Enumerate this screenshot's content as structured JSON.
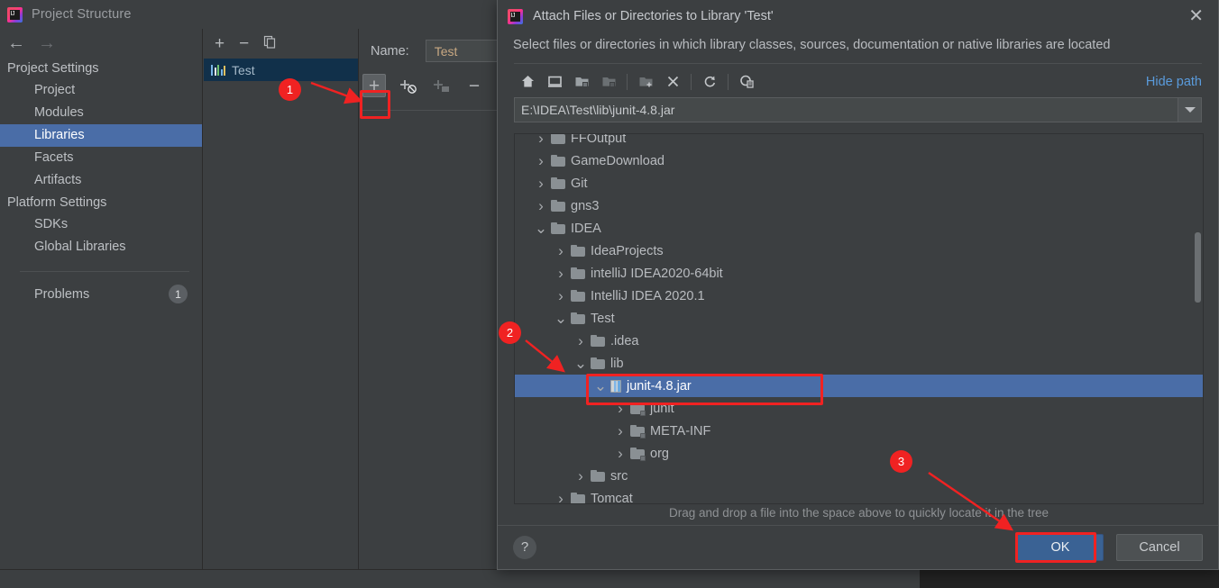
{
  "window": {
    "title": "Project Structure",
    "logo_icon": "intellij-idea-logo",
    "nav_back_icon": "arrow-left-icon",
    "nav_forward_icon": "arrow-right-icon"
  },
  "sidebar": {
    "groups": [
      {
        "label": "Project Settings",
        "items": [
          "Project",
          "Modules",
          "Libraries",
          "Facets",
          "Artifacts"
        ]
      },
      {
        "label": "Platform Settings",
        "items": [
          "SDKs",
          "Global Libraries"
        ]
      }
    ],
    "selected": "Libraries",
    "problems": {
      "label": "Problems",
      "count": "1"
    }
  },
  "library_list": {
    "toolbar": [
      {
        "name": "add-library-button",
        "glyph": "+"
      },
      {
        "name": "remove-library-button",
        "glyph": "−"
      },
      {
        "name": "copy-library-button",
        "glyph": "copy-icon"
      }
    ],
    "items": [
      {
        "label": "Test",
        "icon": "library-icon",
        "selected": true
      }
    ]
  },
  "detail": {
    "name_label": "Name:",
    "name_value": "Test",
    "buttons": [
      {
        "name": "add-attach-button",
        "glyph": "+",
        "state": "highlighted"
      },
      {
        "name": "add-source-button",
        "glyph": "+",
        "state": "normal"
      },
      {
        "name": "add-javadoc-button",
        "glyph": "+",
        "state": "disabled"
      },
      {
        "name": "remove-attachment-button",
        "glyph": "−",
        "state": "normal"
      }
    ]
  },
  "dialog": {
    "logo_icon": "intellij-idea-logo",
    "title": "Attach Files or Directories to Library 'Test'",
    "close_icon": "close-icon",
    "subtitle": "Select files or directories in which library classes, sources, documentation or native libraries are located",
    "toolbar": [
      {
        "name": "home-directory-button",
        "icon": "home-icon"
      },
      {
        "name": "desktop-directory-button",
        "icon": "desktop-icon"
      },
      {
        "name": "project-directory-button",
        "icon": "folder-project-icon"
      },
      {
        "name": "module-directory-button",
        "icon": "folder-module-icon"
      },
      {
        "name": "new-folder-button",
        "icon": "folder-plus-icon"
      },
      {
        "name": "delete-button",
        "icon": "close-x-icon"
      },
      {
        "name": "refresh-button",
        "icon": "refresh-icon"
      },
      {
        "name": "show-hidden-files-button",
        "icon": "hidden-files-icon"
      }
    ],
    "hide_path_label": "Hide path",
    "path_value": "E:\\IDEA\\Test\\lib\\junit-4.8.jar",
    "path_dropdown_icon": "chevron-down-icon",
    "tree": [
      {
        "label": "FFOutput",
        "depth": 1,
        "twisty": "collapsed",
        "icon": "folder",
        "selected": false,
        "clipped": true
      },
      {
        "label": "GameDownload",
        "depth": 1,
        "twisty": "collapsed",
        "icon": "folder",
        "selected": false
      },
      {
        "label": "Git",
        "depth": 1,
        "twisty": "collapsed",
        "icon": "folder",
        "selected": false
      },
      {
        "label": "gns3",
        "depth": 1,
        "twisty": "collapsed",
        "icon": "folder",
        "selected": false
      },
      {
        "label": "IDEA",
        "depth": 1,
        "twisty": "expanded",
        "icon": "folder",
        "selected": false
      },
      {
        "label": "IdeaProjects",
        "depth": 2,
        "twisty": "collapsed",
        "icon": "folder",
        "selected": false
      },
      {
        "label": "intelliJ IDEA2020-64bit",
        "depth": 2,
        "twisty": "collapsed",
        "icon": "folder",
        "selected": false
      },
      {
        "label": "IntelliJ IDEA 2020.1",
        "depth": 2,
        "twisty": "collapsed",
        "icon": "folder",
        "selected": false
      },
      {
        "label": "Test",
        "depth": 2,
        "twisty": "expanded",
        "icon": "folder",
        "selected": false
      },
      {
        "label": ".idea",
        "depth": 3,
        "twisty": "collapsed",
        "icon": "folder",
        "selected": false
      },
      {
        "label": "lib",
        "depth": 3,
        "twisty": "expanded",
        "icon": "folder",
        "selected": false
      },
      {
        "label": "junit-4.8.jar",
        "depth": 4,
        "twisty": "expanded",
        "icon": "jar",
        "selected": true
      },
      {
        "label": "junit",
        "depth": 5,
        "twisty": "collapsed",
        "icon": "package",
        "selected": false
      },
      {
        "label": "META-INF",
        "depth": 5,
        "twisty": "collapsed",
        "icon": "package",
        "selected": false
      },
      {
        "label": "org",
        "depth": 5,
        "twisty": "collapsed",
        "icon": "package",
        "selected": false
      },
      {
        "label": "src",
        "depth": 3,
        "twisty": "collapsed",
        "icon": "folder",
        "selected": false
      },
      {
        "label": "Tomcat",
        "depth": 2,
        "twisty": "collapsed",
        "icon": "folder",
        "selected": false,
        "clipped": true
      }
    ],
    "drag_hint": "Drag and drop a file into the space above to quickly locate it in the tree",
    "help_label": "?",
    "ok_label": "OK",
    "cancel_label": "Cancel"
  },
  "annotations": {
    "markers": [
      {
        "number": "1",
        "target": "add-attach-button"
      },
      {
        "number": "2",
        "target": "junit-jar-tree-row"
      },
      {
        "number": "3",
        "target": "ok-button"
      }
    ],
    "highlight_color": "#f02222"
  }
}
